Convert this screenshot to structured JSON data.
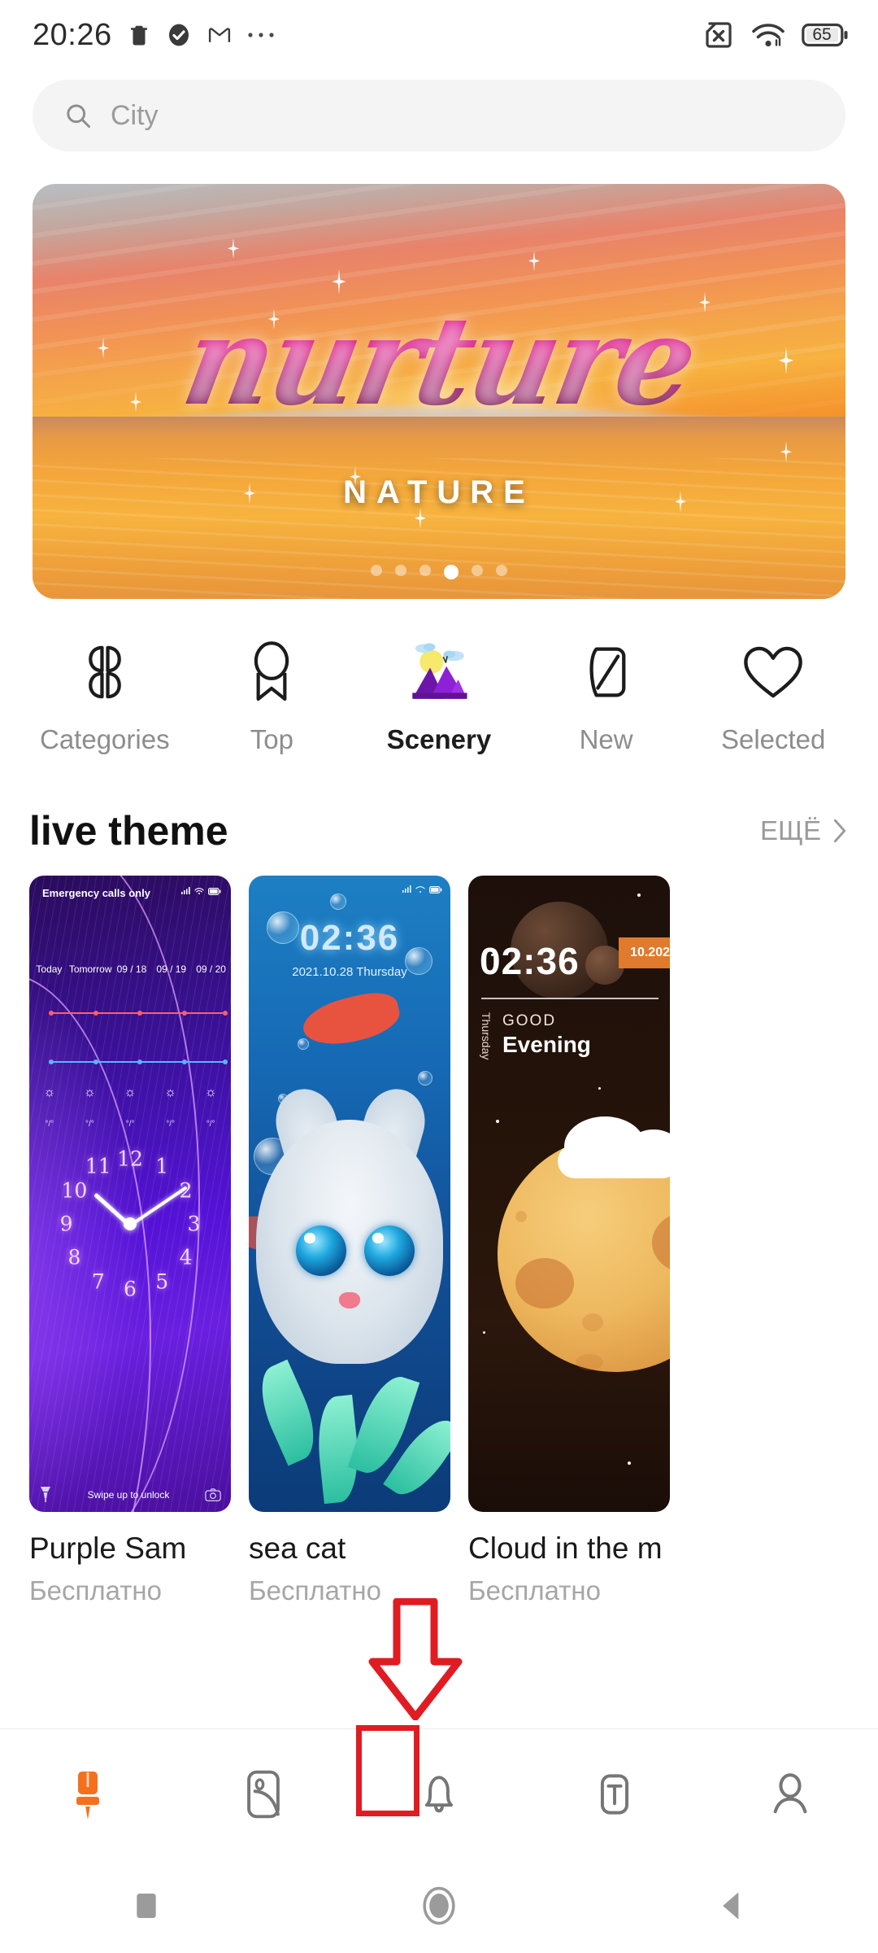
{
  "status_bar": {
    "time": "20:26",
    "left_icons": [
      "trash-icon",
      "check-badge-icon",
      "gmail-icon",
      "more-dots-icon"
    ],
    "right_icons": [
      "sim-card-off-icon",
      "wifi-icon",
      "battery-icon"
    ],
    "battery_level": "65"
  },
  "search": {
    "placeholder": "City",
    "icon": "search-icon"
  },
  "banner": {
    "word": "nurture",
    "subtitle": "NATURE",
    "dot_count": 6,
    "active_dot": 4
  },
  "categories": [
    {
      "label": "Categories",
      "icon": "clover-grid-icon",
      "active": false
    },
    {
      "label": "Top",
      "icon": "ribbon-badge-icon",
      "active": false
    },
    {
      "label": "Scenery",
      "icon": "mountain-scenery-icon",
      "active": true
    },
    {
      "label": "New",
      "icon": "leaf-icon",
      "active": false
    },
    {
      "label": "Selected",
      "icon": "heart-icon",
      "active": false
    }
  ],
  "section": {
    "title": "live theme",
    "more_label": "ЕЩЁ",
    "more_icon": "chevron-right-icon"
  },
  "themes": [
    {
      "title": "Purple Sam",
      "price": "Бесплатно",
      "preview": {
        "carrier": "Emergency calls only",
        "days": [
          "Today",
          "Tomorrow",
          "09 / 18",
          "09 / 19",
          "09 / 20"
        ],
        "degrees": [
          "°/°",
          "°/°",
          "°/°",
          "°/°",
          "°/°"
        ],
        "clock_numbers": [
          "12",
          "1",
          "2",
          "3",
          "4",
          "5",
          "6",
          "7",
          "8",
          "9",
          "10",
          "11"
        ],
        "unlock_hint": "Swipe up to unlock",
        "left_icon": "flashlight-icon",
        "right_icon": "camera-icon"
      }
    },
    {
      "title": "sea cat",
      "price": "Бесплатно",
      "preview": {
        "time": "02:36",
        "date": "2021.10.28 Thursday"
      }
    },
    {
      "title": "Cloud in the m",
      "price": "Бесплатно",
      "preview": {
        "time": "02:36",
        "date_chip": "10.202",
        "greeting_line1": "GOOD",
        "greeting_line2": "Evening",
        "weekday": "Thursday"
      }
    }
  ],
  "bottom_nav": [
    {
      "icon": "paintbrush-icon",
      "active": true
    },
    {
      "icon": "wallpaper-icon",
      "active": false
    },
    {
      "icon": "bell-icon",
      "active": false
    },
    {
      "icon": "font-text-icon",
      "active": false,
      "highlighted": true
    },
    {
      "icon": "profile-icon",
      "active": false
    }
  ],
  "android_nav": [
    {
      "icon": "recents-square-icon"
    },
    {
      "icon": "home-circle-icon"
    },
    {
      "icon": "back-triangle-icon"
    }
  ],
  "annotation": {
    "type": "red-arrow-highlight",
    "target": "font-text-icon",
    "color": "#e01b22"
  },
  "colors": {
    "accent": "#f4701f",
    "annotation": "#e01b22",
    "muted_text": "#9b9b9b",
    "primary_text": "#1a1a1a"
  }
}
